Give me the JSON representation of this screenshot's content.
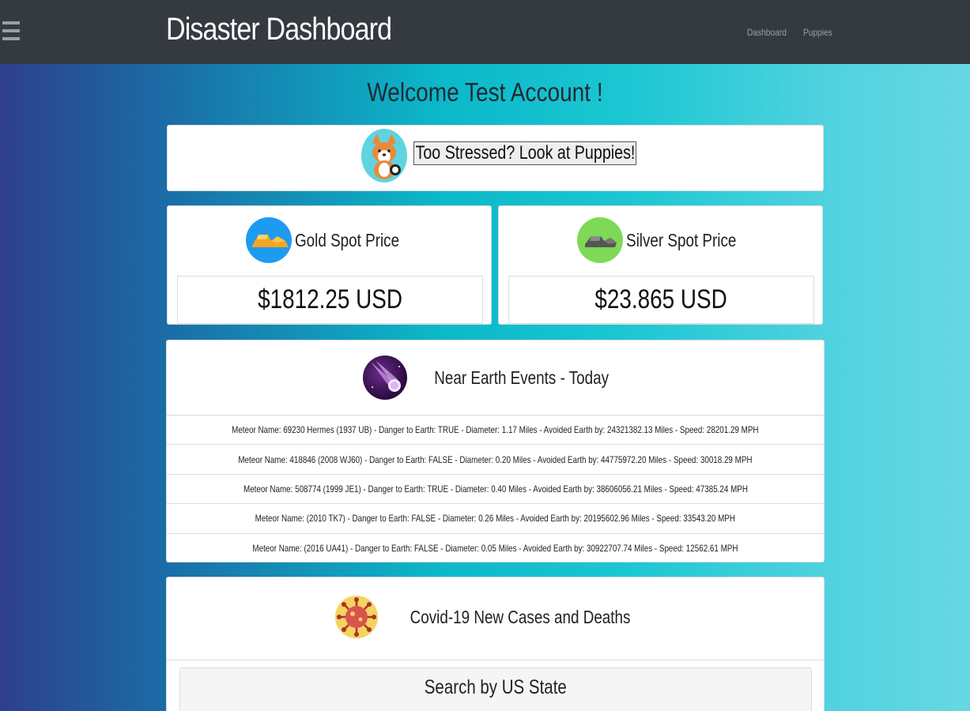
{
  "navbar": {
    "brand": "Disaster Dashboard",
    "links": [
      "Dashboard",
      "Puppies"
    ]
  },
  "welcome": "Welcome Test Account !",
  "puppies": {
    "button_label": "Too Stressed? Look at Puppies!"
  },
  "prices": {
    "gold": {
      "title": "Gold Spot Price",
      "value": "$1812.25 USD"
    },
    "silver": {
      "title": "Silver Spot Price",
      "value": "$23.865 USD"
    }
  },
  "neo": {
    "title": "Near Earth Events - Today",
    "rows": [
      "Meteor Name: 69230 Hermes (1937 UB) - Danger to Earth: TRUE - Diameter: 1.17 Miles - Avoided Earth by: 24321382.13 Miles - Speed: 28201.29 MPH",
      "Meteor Name: 418846 (2008 WJ60) - Danger to Earth: FALSE - Diameter: 0.20 Miles - Avoided Earth by: 44775972.20 Miles - Speed: 30018.29 MPH",
      "Meteor Name: 508774 (1999 JE1) - Danger to Earth: TRUE - Diameter: 0.40 Miles - Avoided Earth by: 38606056.21 Miles - Speed: 47385.24 MPH",
      "Meteor Name: (2010 TK7) - Danger to Earth: FALSE - Diameter: 0.26 Miles - Avoided Earth by: 20195602.96 Miles - Speed: 33543.20 MPH",
      "Meteor Name: (2016 UA41) - Danger to Earth: FALSE - Diameter: 0.05 Miles - Avoided Earth by: 30922707.74 Miles - Speed: 12562.61 MPH"
    ]
  },
  "covid": {
    "title": "Covid-19 New Cases and Deaths",
    "search_title": "Search by US State"
  },
  "icons": {
    "menu": "hamburger-menu-icon",
    "puppy": "corgi-icon",
    "gold": "gold-bars-icon",
    "silver": "silver-bars-icon",
    "meteor": "meteor-icon",
    "covid": "virus-icon"
  },
  "colors": {
    "navbar": "#343a40",
    "gold_icon_bg": "#1d9bf0",
    "silver_icon_bg": "#7ed957"
  }
}
